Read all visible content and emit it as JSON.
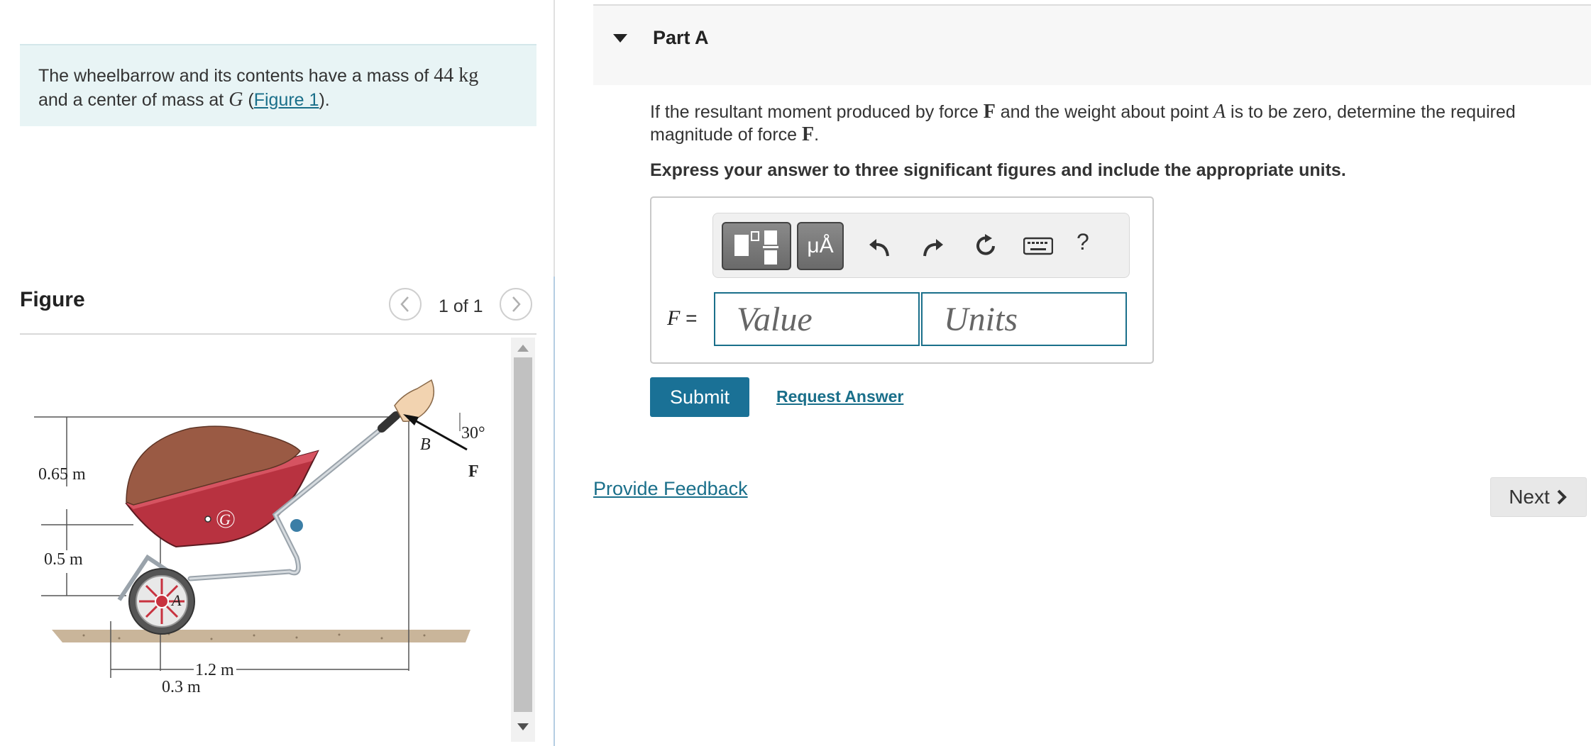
{
  "problem": {
    "text_before": "The wheelbarrow and its contents have a mass of ",
    "mass_value": "44",
    "mass_unit": "kg",
    "text_middle": "and a center of mass at ",
    "cm_symbol": "G",
    "paren_open": " (",
    "figure_link": "Figure 1",
    "paren_close": ")."
  },
  "figure": {
    "title": "Figure",
    "pager": "1 of 1",
    "labels": {
      "dim_065": "0.65 m",
      "dim_05": "0.5 m",
      "dim_03": "0.3 m",
      "dim_12": "1.2 m",
      "angle": "30°",
      "point_b": "B",
      "point_a": "A",
      "point_g": "G",
      "force": "F"
    }
  },
  "part": {
    "title": "Part A",
    "q_text1": "If the resultant moment produced by force ",
    "q_force": "F",
    "q_text2": " and the weight about point ",
    "q_point": "A",
    "q_text3": " is to be zero, determine the required magnitude of force ",
    "q_force2": "F",
    "q_end": ".",
    "instruction": "Express your answer to three significant figures and include the appropriate units."
  },
  "toolbar": {
    "units_symbol": "μÅ",
    "help": "?"
  },
  "answer": {
    "variable": "F",
    "equals": " =",
    "value_placeholder": "Value",
    "units_placeholder": "Units"
  },
  "actions": {
    "submit": "Submit",
    "request_answer": "Request Answer",
    "provide_feedback": "Provide Feedback",
    "next": "Next"
  },
  "colors": {
    "link": "#1a6f8a",
    "submit_bg": "#1a7196",
    "problem_bg": "#e8f4f5",
    "barrow_red": "#b83240",
    "soil_brown": "#9a5a44"
  }
}
